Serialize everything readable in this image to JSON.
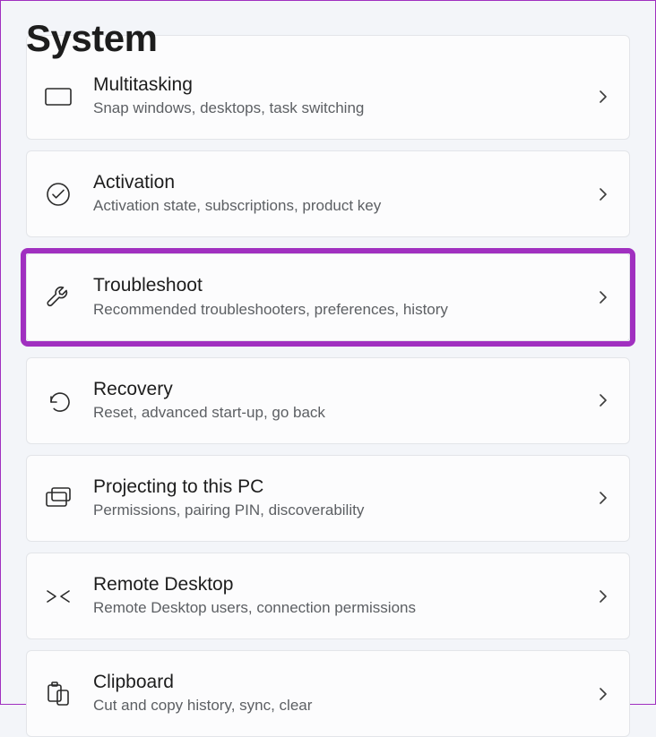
{
  "header": {
    "title": "System"
  },
  "items": [
    {
      "key": "multitasking",
      "title": "Multitasking",
      "sub": "Snap windows, desktops, task switching",
      "icon": "multitasking-icon",
      "partial": "top"
    },
    {
      "key": "activation",
      "title": "Activation",
      "sub": "Activation state, subscriptions, product key",
      "icon": "checkmark-circle-icon"
    },
    {
      "key": "troubleshoot",
      "title": "Troubleshoot",
      "sub": "Recommended troubleshooters, preferences, history",
      "icon": "wrench-icon",
      "highlight": true
    },
    {
      "key": "recovery",
      "title": "Recovery",
      "sub": "Reset, advanced start-up, go back",
      "icon": "recovery-icon"
    },
    {
      "key": "projecting",
      "title": "Projecting to this PC",
      "sub": "Permissions, pairing PIN, discoverability",
      "icon": "projecting-icon"
    },
    {
      "key": "remote-desktop",
      "title": "Remote Desktop",
      "sub": "Remote Desktop users, connection permissions",
      "icon": "remote-desktop-icon"
    },
    {
      "key": "clipboard",
      "title": "Clipboard",
      "sub": "Cut and copy history, sync, clear",
      "icon": "clipboard-icon",
      "partial": "bottom"
    }
  ]
}
